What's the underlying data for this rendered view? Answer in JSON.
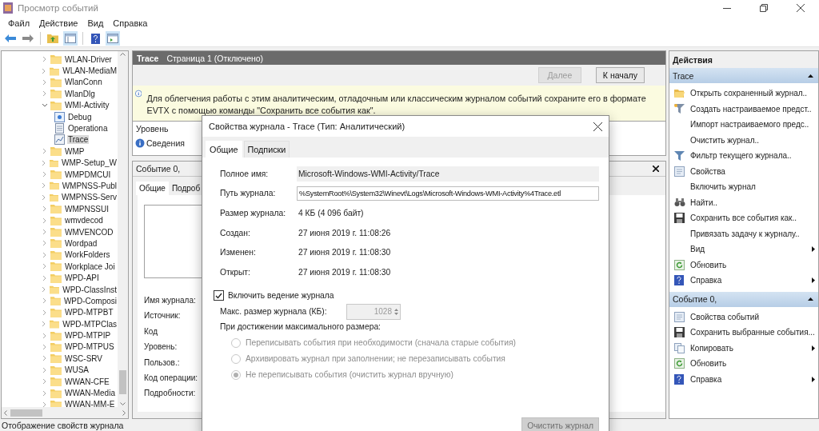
{
  "window": {
    "title": "Просмотр событий"
  },
  "menu": [
    "Файл",
    "Действие",
    "Вид",
    "Справка"
  ],
  "tree": {
    "items": [
      {
        "label": "WLAN-Driver",
        "expanded": false,
        "selected": false
      },
      {
        "label": "WLAN-MediaM",
        "expanded": false,
        "selected": false
      },
      {
        "label": "WlanConn",
        "expanded": false,
        "selected": false
      },
      {
        "label": "WlanDlg",
        "expanded": false,
        "selected": false
      },
      {
        "label": "WMI-Activity",
        "expanded": true,
        "selected": false,
        "children": [
          {
            "label": "Debug",
            "kind": "debug",
            "selected": false
          },
          {
            "label": "Operationa",
            "kind": "operational",
            "selected": false
          },
          {
            "label": "Trace",
            "kind": "analytic",
            "selected": true
          }
        ]
      },
      {
        "label": "WMP",
        "expanded": false,
        "selected": false
      },
      {
        "label": "WMP-Setup_W",
        "expanded": false,
        "selected": false
      },
      {
        "label": "WMPDMCUI",
        "expanded": false,
        "selected": false
      },
      {
        "label": "WMPNSS-Publ",
        "expanded": false,
        "selected": false
      },
      {
        "label": "WMPNSS-Serv",
        "expanded": false,
        "selected": false
      },
      {
        "label": "WMPNSSUI",
        "expanded": false,
        "selected": false
      },
      {
        "label": "wmvdecod",
        "expanded": false,
        "selected": false
      },
      {
        "label": "WMVENCOD",
        "expanded": false,
        "selected": false
      },
      {
        "label": "Wordpad",
        "expanded": false,
        "selected": false
      },
      {
        "label": "WorkFolders",
        "expanded": false,
        "selected": false
      },
      {
        "label": "Workplace Joi",
        "expanded": false,
        "selected": false
      },
      {
        "label": "WPD-API",
        "expanded": false,
        "selected": false
      },
      {
        "label": "WPD-ClassInst",
        "expanded": false,
        "selected": false
      },
      {
        "label": "WPD-Composi",
        "expanded": false,
        "selected": false
      },
      {
        "label": "WPD-MTPBT",
        "expanded": false,
        "selected": false
      },
      {
        "label": "WPD-MTPClas",
        "expanded": false,
        "selected": false
      },
      {
        "label": "WPD-MTPIP",
        "expanded": false,
        "selected": false
      },
      {
        "label": "WPD-MTPUS",
        "expanded": false,
        "selected": false
      },
      {
        "label": "WSC-SRV",
        "expanded": false,
        "selected": false
      },
      {
        "label": "WUSA",
        "expanded": false,
        "selected": false
      },
      {
        "label": "WWAN-CFE",
        "expanded": false,
        "selected": false
      },
      {
        "label": "WWAN-Media",
        "expanded": false,
        "selected": false
      },
      {
        "label": "WWAN-MM-E",
        "expanded": false,
        "selected": false
      }
    ]
  },
  "log_header": {
    "title": "Trace",
    "subtitle": "Страница 1 (Отключено)"
  },
  "nav_buttons": [
    {
      "label": "Далее",
      "disabled": true
    },
    {
      "label": "К началу",
      "disabled": false
    }
  ],
  "info_banner": "Для облегчения работы с этим аналитическим, отладочным или классическим журналом событий сохраните его в формате EVTX с помощью команды \"Сохранить все события как\".",
  "events_table": {
    "columns": [
      "Уровень"
    ],
    "rows": [
      {
        "cells": [
          "Сведения"
        ]
      }
    ]
  },
  "event_pane": {
    "title": "Событие 0,",
    "tabs": [
      {
        "label": "Общие",
        "selected": true
      },
      {
        "label": "Подроб",
        "selected": false
      }
    ],
    "fields": [
      "Имя журнала:",
      "Источник:",
      "Код",
      "Уровень:",
      "Пользов.:",
      "Код операции:",
      "Подробности:"
    ]
  },
  "dialog": {
    "title": "Свойства журнала - Trace (Тип: Аналитический)",
    "tabs": [
      {
        "label": "Общие",
        "selected": true
      },
      {
        "label": "Подписки",
        "selected": false
      }
    ],
    "properties": [
      {
        "label": "Полное имя:",
        "value": "Microsoft-Windows-WMI-Activity/Trace",
        "kind": "readonly"
      },
      {
        "label": "Путь журнала:",
        "value": "%SystemRoot%\\System32\\Winevt\\Logs\\Microsoft-Windows-WMI-Activity%4Trace.etl",
        "kind": "field"
      },
      {
        "label": "Размер журнала:",
        "value": "4 КБ (4 096 байт)",
        "kind": "text"
      },
      {
        "label": "Создан:",
        "value": "27 июня 2019 г. 11:08:26",
        "kind": "text"
      },
      {
        "label": "Изменен:",
        "value": "27 июня 2019 г. 11:08:30",
        "kind": "text"
      },
      {
        "label": "Открыт:",
        "value": "27 июня 2019 г. 11:08:30",
        "kind": "text"
      }
    ],
    "enable_logging": {
      "label": "Включить ведение журнала",
      "checked": true
    },
    "max_size": {
      "label": "Макс. размер журнала (КБ):",
      "value": "1028",
      "disabled": true
    },
    "policy_label": "При достижении максимального размера:",
    "policies": [
      {
        "label": "Переписывать события при необходимости (сначала старые события)",
        "selected": false,
        "disabled": true
      },
      {
        "label": "Архивировать журнал при заполнении; не перезаписывать события",
        "selected": false,
        "disabled": true
      },
      {
        "label": "Не переписывать события (очистить журнал вручную)",
        "selected": true,
        "disabled": true
      }
    ],
    "clear_button": {
      "label": "Очистить журнал",
      "disabled": true
    }
  },
  "actions": {
    "title": "Действия",
    "sections": [
      {
        "title": "Trace",
        "expanded": true,
        "items": [
          {
            "label": "Открыть сохраненный журнал..",
            "kind": "open",
            "submenu": false
          },
          {
            "label": "Создать настраиваемое предст..",
            "kind": "create",
            "submenu": false
          },
          {
            "label": "Импорт настраиваемого предс..",
            "kind": "plain",
            "submenu": false
          },
          {
            "label": "Очистить журнал..",
            "kind": "plain",
            "submenu": false
          },
          {
            "label": "Фильтр текущего журнала..",
            "kind": "filter",
            "submenu": false
          },
          {
            "label": "Свойства",
            "kind": "properties",
            "submenu": false
          },
          {
            "label": "Включить журнал",
            "kind": "plain",
            "submenu": false
          },
          {
            "label": "Найти..",
            "kind": "find",
            "submenu": false
          },
          {
            "label": "Сохранить все события как..",
            "kind": "save",
            "submenu": false
          },
          {
            "label": "Привязать задачу к журналу..",
            "kind": "plain",
            "submenu": false
          },
          {
            "label": "Вид",
            "kind": "plain",
            "submenu": true
          },
          {
            "label": "Обновить",
            "kind": "refresh",
            "submenu": false
          },
          {
            "label": "Справка",
            "kind": "help",
            "submenu": true
          }
        ]
      },
      {
        "title": "Событие 0,",
        "expanded": true,
        "items": [
          {
            "label": "Свойства событий",
            "kind": "properties",
            "submenu": false
          },
          {
            "label": "Сохранить выбранные события...",
            "kind": "save",
            "submenu": false
          },
          {
            "label": "Копировать",
            "kind": "copy",
            "submenu": true
          },
          {
            "label": "Обновить",
            "kind": "refresh",
            "submenu": false
          },
          {
            "label": "Справка",
            "kind": "help",
            "submenu": true
          }
        ]
      }
    ]
  },
  "status_bar": "Отображение свойств журнала"
}
